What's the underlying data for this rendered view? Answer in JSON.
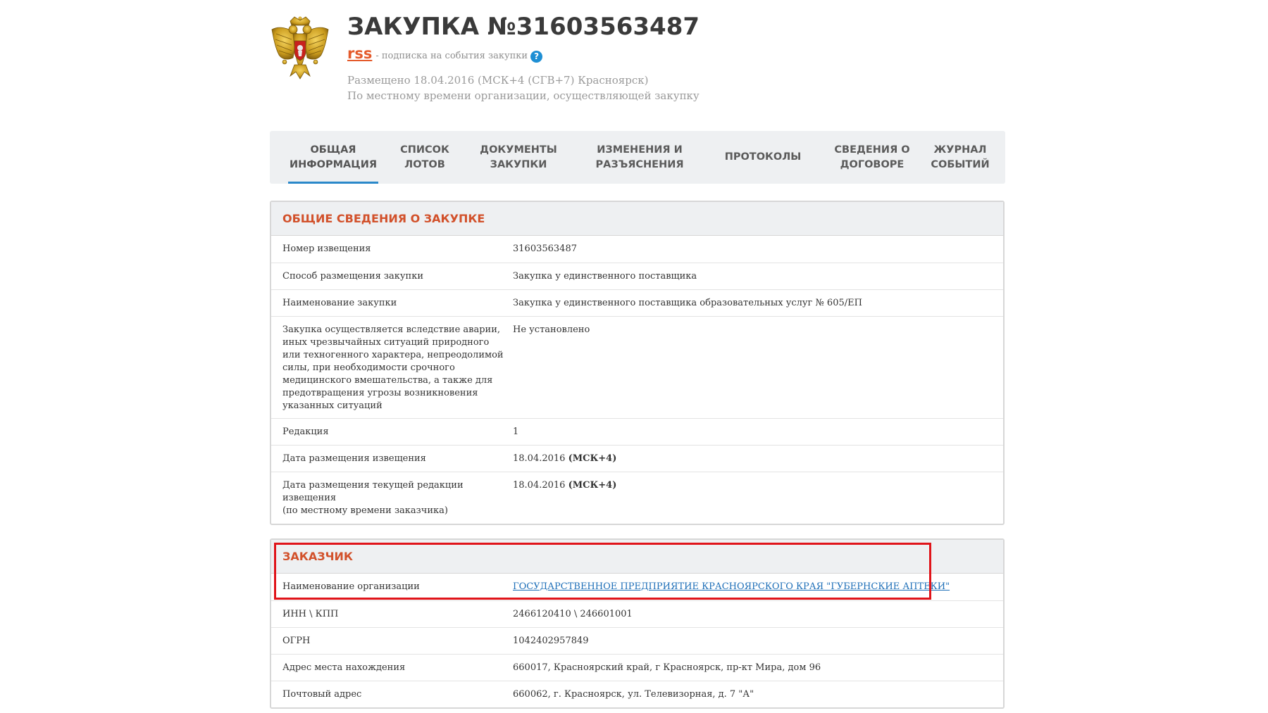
{
  "header": {
    "title": "ЗАКУПКА №31603563487",
    "rss_label": "rss",
    "rss_text": "- подписка на события закупки",
    "help_icon": "question-icon",
    "posted_line1": "Размещено 18.04.2016 (МСК+4 (СГВ+7) Красноярск)",
    "posted_line2": "По местному времени организации, осуществляющей закупку"
  },
  "tabs": [
    {
      "label": "ОБЩАЯ\nИНФОРМАЦИЯ",
      "active": true
    },
    {
      "label": "СПИСОК\nЛОТОВ"
    },
    {
      "label": "ДОКУМЕНТЫ\nЗАКУПКИ"
    },
    {
      "label": "ИЗМЕНЕНИЯ И\nРАЗЪЯСНЕНИЯ"
    },
    {
      "label": "ПРОТОКОЛЫ"
    },
    {
      "label": "СВЕДЕНИЯ О\nДОГОВОРЕ"
    },
    {
      "label": "ЖУРНАЛ\nСОБЫТИЙ"
    }
  ],
  "general": {
    "title": "ОБЩИЕ СВЕДЕНИЯ О ЗАКУПКЕ",
    "rows": [
      {
        "label": "Номер извещения",
        "value": "31603563487"
      },
      {
        "label": "Способ размещения закупки",
        "value": "Закупка у единственного поставщика"
      },
      {
        "label": "Наименование закупки",
        "value": "Закупка у единственного поставщика образовательных услуг № 605/ЕП"
      },
      {
        "label": "Закупка осуществляется вследствие аварии,\nиных чрезвычайных ситуаций природного\nили техногенного характера, непреодолимой\nсилы, при необходимости срочного\nмедицинского вмешательства, а также для\nпредотвращения угрозы возникновения\nуказанных ситуаций",
        "value": "Не установлено"
      },
      {
        "label": "Редакция",
        "value": "1"
      },
      {
        "label": "Дата размещения извещения",
        "value": "18.04.2016",
        "value_suffix": "(МСК+4)"
      },
      {
        "label": "Дата размещения текущей редакции\nизвещения\n(по местному времени заказчика)",
        "value": "18.04.2016",
        "value_suffix": "(МСК+4)"
      }
    ]
  },
  "customer": {
    "title": "ЗАКАЗЧИК",
    "org_label": "Наименование организации",
    "org_value": "ГОСУДАРСТВЕННОЕ ПРЕДПРИЯТИЕ КРАСНОЯРСКОГО КРАЯ \"ГУБЕРНСКИЕ АПТЕКИ\"",
    "rows": [
      {
        "label": "ИНН \\ КПП",
        "value": "2466120410 \\ 246601001"
      },
      {
        "label": "ОГРН",
        "value": "1042402957849"
      },
      {
        "label": "Адрес места нахождения",
        "value": "660017, Красноярский край, г Красноярск, пр-кт Мира, дом 96"
      },
      {
        "label": "Почтовый адрес",
        "value": "660062, г. Красноярск, ул. Телевизорная, д. 7 \"А\""
      }
    ]
  },
  "colors": {
    "accent_orange": "#d2512b",
    "link_blue": "#1e6fb8",
    "tab_underline": "#2a88c9",
    "highlight_red": "#e0141a"
  }
}
